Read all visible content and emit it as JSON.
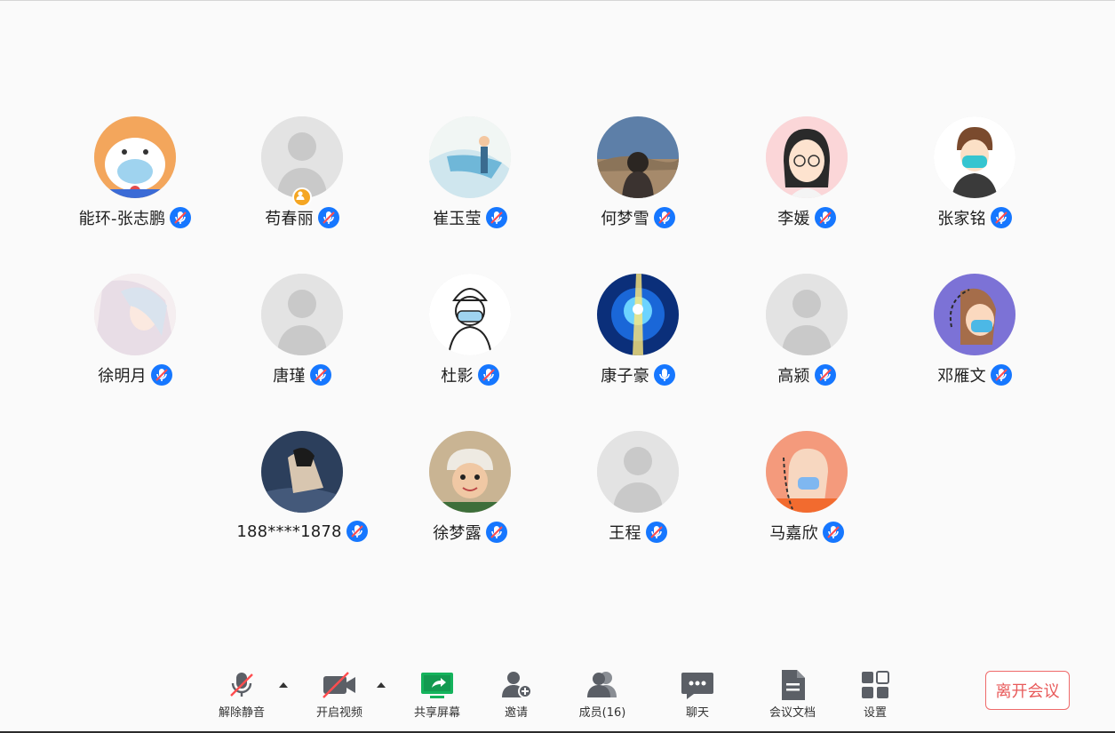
{
  "participants": [
    {
      "name": "能环-张志鹏",
      "mic": "muted",
      "avatar": "cartoon-bear-mask"
    },
    {
      "name": "苟春丽",
      "mic": "muted",
      "avatar": "default",
      "host": true
    },
    {
      "name": "崔玉莹",
      "mic": "muted",
      "avatar": "anime-girl"
    },
    {
      "name": "何梦雪",
      "mic": "muted",
      "avatar": "photo-landscape"
    },
    {
      "name": "李媛",
      "mic": "muted",
      "avatar": "cartoon-girl-glasses"
    },
    {
      "name": "张家铭",
      "mic": "muted",
      "avatar": "cartoon-boy-mask"
    },
    {
      "name": "徐明月",
      "mic": "muted",
      "avatar": "anime-portrait"
    },
    {
      "name": "唐瑾",
      "mic": "muted",
      "avatar": "default"
    },
    {
      "name": "杜影",
      "mic": "muted",
      "avatar": "sketch-girl-mask"
    },
    {
      "name": "康子豪",
      "mic": "on",
      "avatar": "blue-light"
    },
    {
      "name": "高颍",
      "mic": "muted",
      "avatar": "default"
    },
    {
      "name": "邓雁文",
      "mic": "muted",
      "avatar": "child-mask-purple"
    },
    {
      "name": "188****1878",
      "mic": "muted",
      "avatar": "anime-dark"
    },
    {
      "name": "徐梦露",
      "mic": "muted",
      "avatar": "child-helmet-photo"
    },
    {
      "name": "王程",
      "mic": "muted",
      "avatar": "default"
    },
    {
      "name": "马嘉欣",
      "mic": "muted",
      "avatar": "child-mask-orange"
    }
  ],
  "toolbar": {
    "unmute": "解除静音",
    "start_video": "开启视频",
    "share_screen": "共享屏幕",
    "invite": "邀请",
    "members": "成员(16)",
    "chat": "聊天",
    "meeting_docs": "会议文档",
    "settings": "设置",
    "leave": "离开会议"
  },
  "colors": {
    "accent": "#1677ff",
    "host_badge": "#f5a623",
    "share_green": "#14b35c",
    "leave_red": "#e85a5a",
    "icon_gray": "#5b5f66"
  }
}
